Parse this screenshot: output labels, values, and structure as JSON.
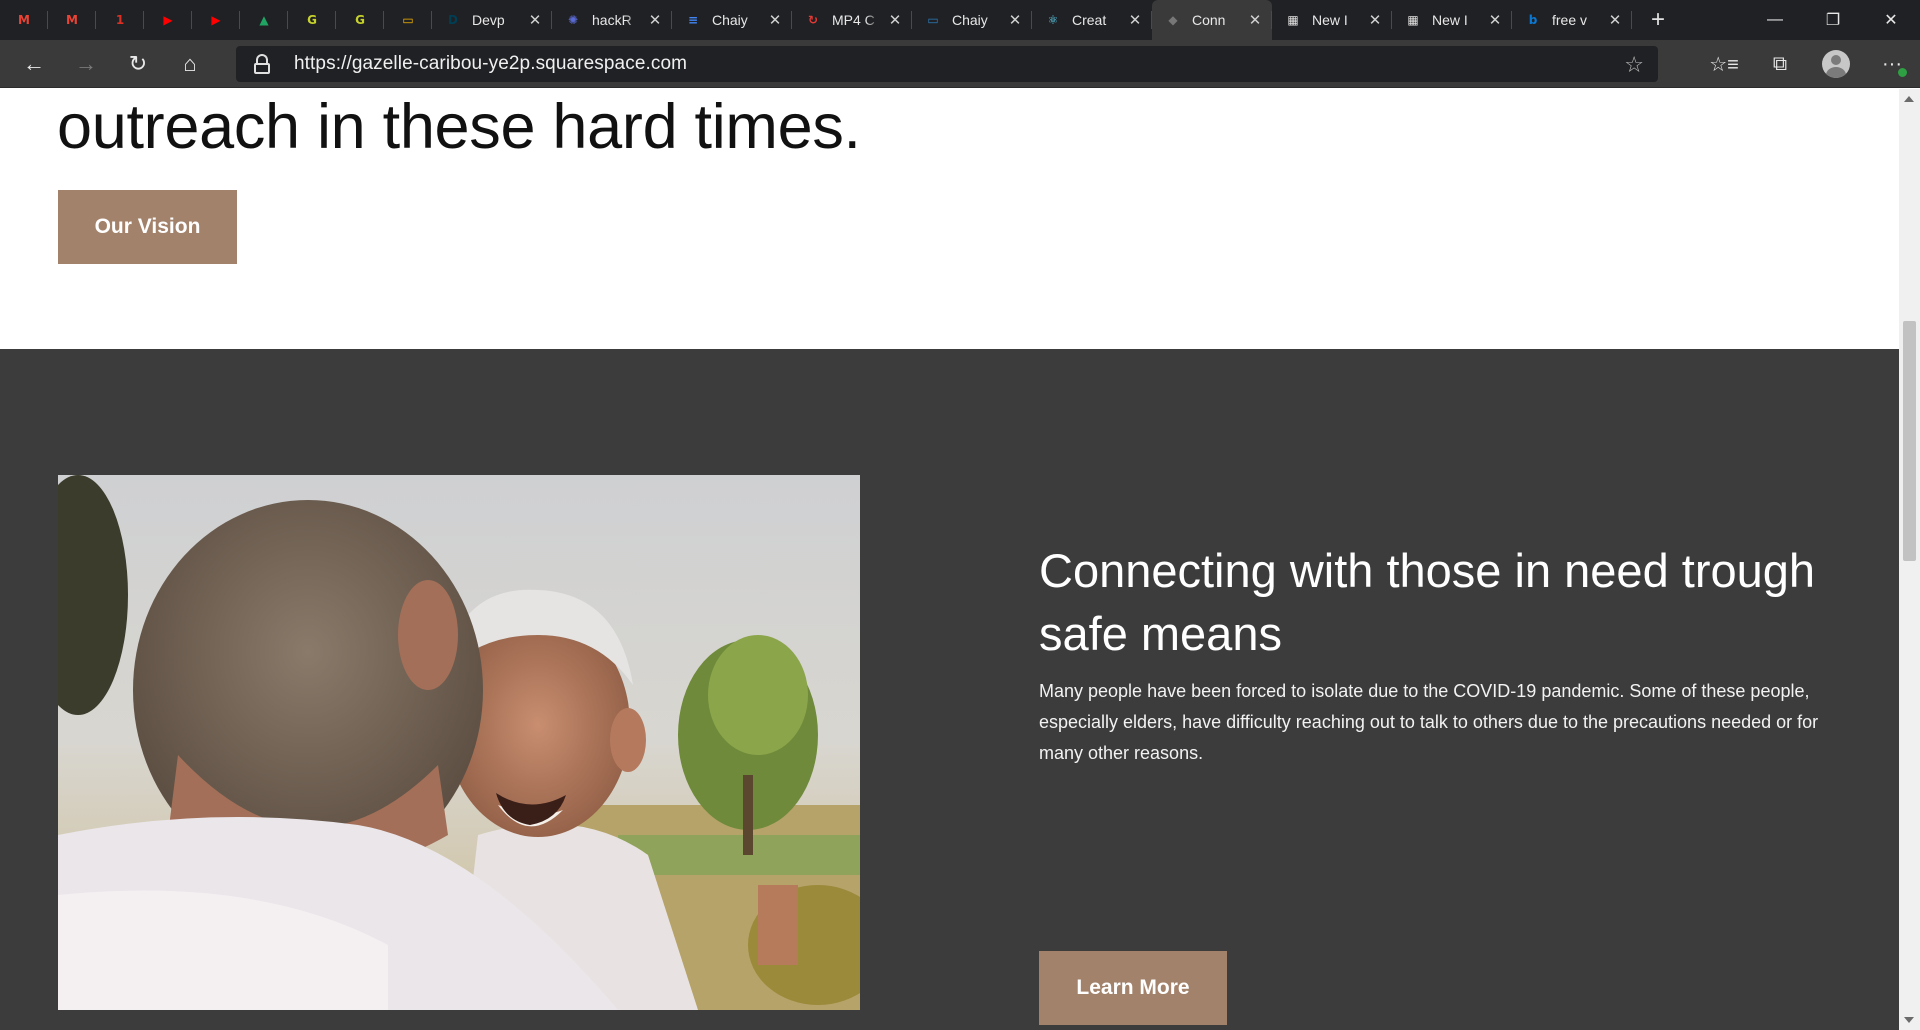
{
  "browser": {
    "pinned_tabs": [
      {
        "icon": "gmail-icon",
        "color": "#EA4335",
        "glyph": "M"
      },
      {
        "icon": "gmail-icon",
        "color": "#EA4335",
        "glyph": "M"
      },
      {
        "icon": "calendar-icon",
        "color": "#d93025",
        "glyph": "1"
      },
      {
        "icon": "youtube-icon",
        "color": "#ff0000",
        "glyph": "▶"
      },
      {
        "icon": "youtube-icon",
        "color": "#ff0000",
        "glyph": "▶"
      },
      {
        "icon": "google-drive-icon",
        "color": "#1fa463",
        "glyph": "▲"
      },
      {
        "icon": "grammarly-icon",
        "color": "#c6d22b",
        "glyph": "G"
      },
      {
        "icon": "grammarly-icon",
        "color": "#c6d22b",
        "glyph": "G"
      },
      {
        "icon": "google-slides-icon",
        "color": "#f4b400",
        "glyph": "▭"
      }
    ],
    "tabs": [
      {
        "title": "Devp",
        "icon": "devpost-icon",
        "color": "#003e54",
        "glyph": "D",
        "active": false
      },
      {
        "title": "hackR",
        "icon": "hackathon-icon",
        "color": "#5b6bd6",
        "glyph": "✺",
        "active": false
      },
      {
        "title": "Chaiy",
        "icon": "google-docs-icon",
        "color": "#4285f4",
        "glyph": "≡",
        "active": false
      },
      {
        "title": "MP4 C",
        "icon": "converter-icon",
        "color": "#e53935",
        "glyph": "↻",
        "active": false
      },
      {
        "title": "Chaiy",
        "icon": "slides-icon",
        "color": "#2b7bb9",
        "glyph": "▭",
        "active": false
      },
      {
        "title": "Creat",
        "icon": "react-icon",
        "color": "#61dafb",
        "glyph": "⚛",
        "active": false
      },
      {
        "title": "Conn",
        "icon": "squarespace-icon",
        "color": "#777777",
        "glyph": "◆",
        "active": true
      },
      {
        "title": "New I",
        "icon": "new-tab-icon",
        "color": "#202124",
        "glyph": "▦",
        "active": false
      },
      {
        "title": "New I",
        "icon": "new-tab-icon",
        "color": "#202124",
        "glyph": "▦",
        "active": false
      },
      {
        "title": "free v",
        "icon": "bing-icon",
        "color": "#0a78d4",
        "glyph": "b",
        "active": false
      }
    ],
    "new_tab_glyph": "+",
    "window": {
      "minimize": "—",
      "restore": "❐",
      "close": "✕"
    },
    "nav": {
      "back": "←",
      "forward": "→",
      "refresh": "↻",
      "home": "⌂"
    },
    "url": "https://gazelle-caribou-ye2p.squarespace.com",
    "right": {
      "favorite_star": "☆",
      "favorites": "☆≡",
      "collections": "⧉",
      "more": "···"
    }
  },
  "page": {
    "headline": "outreach in these hard times.",
    "vision_button": "Our Vision",
    "section": {
      "title": "Connecting with those in need trough safe means",
      "body": "Many people have been forced to isolate due to the COVID-19 pandemic. Some of these people, especially elders, have difficulty reaching out to talk to others due to the precautions needed or for many other reasons.",
      "button": "Learn More"
    },
    "colors": {
      "accent": "#a3826b",
      "section_bg": "#3c3c3c"
    }
  }
}
